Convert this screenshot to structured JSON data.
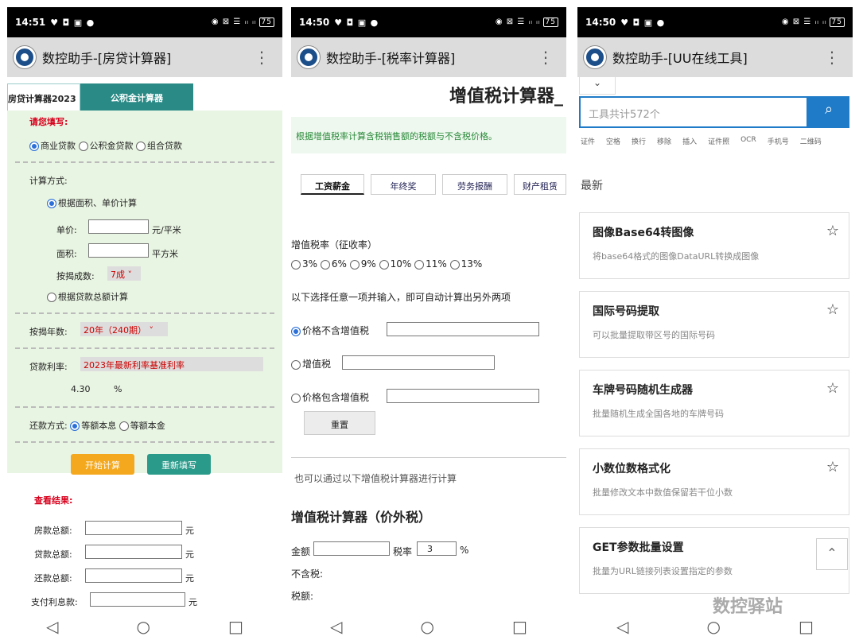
{
  "p1": {
    "status_time": "14:51",
    "title": "数控助手-[房贷计算器]",
    "tab_a": "房贷计算器2023",
    "tab_b": "公积金计算器",
    "fill": "请您填写:",
    "loan_types": [
      "商业贷款",
      "公积金贷款",
      "组合贷款"
    ],
    "calc_method": "计算方式:",
    "by_area": "根据面积、单价计算",
    "unit_price": "单价:",
    "unit_price_unit": "元/平米",
    "area": "面积:",
    "area_unit": "平方米",
    "down": "按揭成数:",
    "down_val": "7成",
    "by_total": "根据贷款总额计算",
    "years": "按揭年数:",
    "years_val": "20年（240期）",
    "rate": "贷款利率:",
    "rate_val": "2023年最新利率基准利率",
    "rate_num": "4.30",
    "pct": "%",
    "repay": "还款方式:",
    "repay1": "等额本息",
    "repay2": "等额本金",
    "start": "开始计算",
    "reset": "重新填写",
    "result": "查看结果:",
    "r1": "房款总额:",
    "r2": "贷款总额:",
    "r3": "还款总额:",
    "r4": "支付利息款:",
    "yuan": "元"
  },
  "p2": {
    "status_time": "14:50",
    "title": "数控助手-[税率计算器]",
    "heading": "增值税计算器_",
    "banner": "根据增值税率计算含税销售额的税额与不含税价格。",
    "tabs": [
      "工资薪金",
      "年终奖",
      "劳务报酬",
      "财产租赁"
    ],
    "rate_label": "增值税率（征收率）",
    "rates": [
      "3%",
      "6%",
      "9%",
      "10%",
      "11%",
      "13%"
    ],
    "hint": "以下选择任意一项并输入，即可自动计算出另外两项",
    "opt1": "价格不含增值税",
    "opt2": "增值税",
    "opt3": "价格包含增值税",
    "clear": "重置",
    "also": "也可以通过以下增值税计算器进行计算",
    "h3": "增值税计算器（价外税）",
    "amount": "金额",
    "rate2": "税率",
    "rate2_val": "3",
    "pct": "%",
    "notax": "不含税:",
    "tax": "税额:"
  },
  "p3": {
    "status_time": "14:50",
    "title": "数控助手-[UU在线工具]",
    "search_ph": "工具共计572个",
    "tags": [
      "证件",
      "空格",
      "换行",
      "移除",
      "插入",
      "证件照",
      "OCR",
      "手机号",
      "二维码"
    ],
    "latest": "最新",
    "cards": [
      {
        "t": "图像Base64转图像",
        "d": "将base64格式的图像DataURL转换成图像"
      },
      {
        "t": "国际号码提取",
        "d": "可以批量提取带区号的国际号码"
      },
      {
        "t": "车牌号码随机生成器",
        "d": "批量随机生成全国各地的车牌号码"
      },
      {
        "t": "小数位数格式化",
        "d": "批量修改文本中数值保留若干位小数"
      },
      {
        "t": "GET参数批量设置",
        "d": "批量为URL链接列表设置指定的参数"
      }
    ]
  },
  "watermark": "数控驿站"
}
